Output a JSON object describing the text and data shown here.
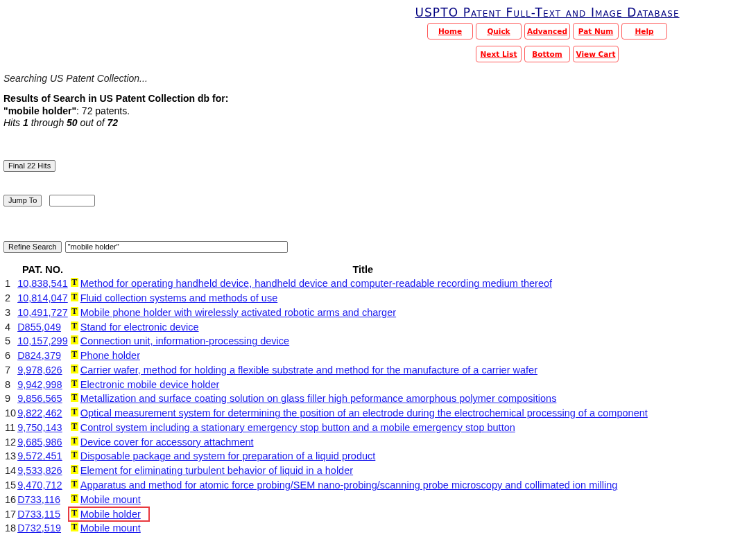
{
  "header": {
    "title": "USPTO Patent Full-Text and Image Database",
    "nav_rows": [
      {
        "buttons": [
          "Home",
          "Quick",
          "Advanced",
          "Pat Num",
          "Help"
        ]
      },
      {
        "buttons": [
          "Next List",
          "Bottom",
          "View Cart"
        ]
      }
    ]
  },
  "status": "Searching US Patent Collection...",
  "results": {
    "heading": "Results of Search in US Patent Collection db for:",
    "query_line": "**\"mobile holder\"**: 72 patents.",
    "hits_line": "Hits **1** through **50** out of **72**"
  },
  "final_button": "Final 22 Hits",
  "jump": {
    "button": "Jump To"
  },
  "refine": {
    "button": "Refine Search",
    "value": "\"mobile holder\""
  },
  "table": {
    "columns": [
      "PAT. NO.",
      "Title"
    ],
    "rows": [
      {
        "number": "1",
        "patent": "10,838,541",
        "icon": "T",
        "title": "Method for operating handheld device, handheld device and computer-readable recording medium thereof",
        "highlighted": false
      },
      {
        "number": "2",
        "patent": "10,814,047",
        "icon": "T",
        "title": "Fluid collection systems and methods of use",
        "highlighted": false
      },
      {
        "number": "3",
        "patent": "10,491,727",
        "icon": "T",
        "title": "Mobile phone holder with wirelessly activated robotic arms and charger",
        "highlighted": false
      },
      {
        "number": "4",
        "patent": "D855,049",
        "icon": "T",
        "title": "Stand for electronic device",
        "highlighted": false
      },
      {
        "number": "5",
        "patent": "10,157,299",
        "icon": "T",
        "title": "Connection unit, information-processing device",
        "highlighted": false
      },
      {
        "number": "6",
        "patent": "D824,379",
        "icon": "T",
        "title": "Phone holder",
        "highlighted": false
      },
      {
        "number": "7",
        "patent": "9,978,626",
        "icon": "T",
        "title": "Carrier wafer, method for holding a flexible substrate and method for the manufacture of a carrier wafer",
        "highlighted": false
      },
      {
        "number": "8",
        "patent": "9,942,998",
        "icon": "T",
        "title": "Electronic mobile device holder",
        "highlighted": false
      },
      {
        "number": "9",
        "patent": "9,856,565",
        "icon": "T",
        "title": "Metallization and surface coating solution on glass filler high peformance amorphous polymer compositions",
        "highlighted": false
      },
      {
        "number": "10",
        "patent": "9,822,462",
        "icon": "T",
        "title": "Optical measurement system for determining the position of an electrode during the electrochemical processing of a component",
        "highlighted": false
      },
      {
        "number": "11",
        "patent": "9,750,143",
        "icon": "T",
        "title": "Control system including a stationary emergency stop button and a mobile emergency stop button",
        "highlighted": false
      },
      {
        "number": "12",
        "patent": "9,685,986",
        "icon": "T",
        "title": "Device cover for accessory attachment",
        "highlighted": false
      },
      {
        "number": "13",
        "patent": "9,572,451",
        "icon": "T",
        "title": "Disposable package and system for preparation of a liquid product",
        "highlighted": false
      },
      {
        "number": "14",
        "patent": "9,533,826",
        "icon": "T",
        "title": "Element for eliminating turbulent behavior of liquid in a holder",
        "highlighted": false
      },
      {
        "number": "15",
        "patent": "9,470,712",
        "icon": "T",
        "title": "Apparatus and method for atomic force probing/SEM nano-probing/scanning probe microscopy and collimated ion milling",
        "highlighted": false
      },
      {
        "number": "16",
        "patent": "D733,116",
        "icon": "T",
        "title": "Mobile mount",
        "highlighted": false
      },
      {
        "number": "17",
        "patent": "D733,115",
        "icon": "T",
        "title": "Mobile holder",
        "highlighted": true
      },
      {
        "number": "18",
        "patent": "D732,519",
        "icon": "T",
        "title": "Mobile mount",
        "highlighted": false
      }
    ]
  }
}
